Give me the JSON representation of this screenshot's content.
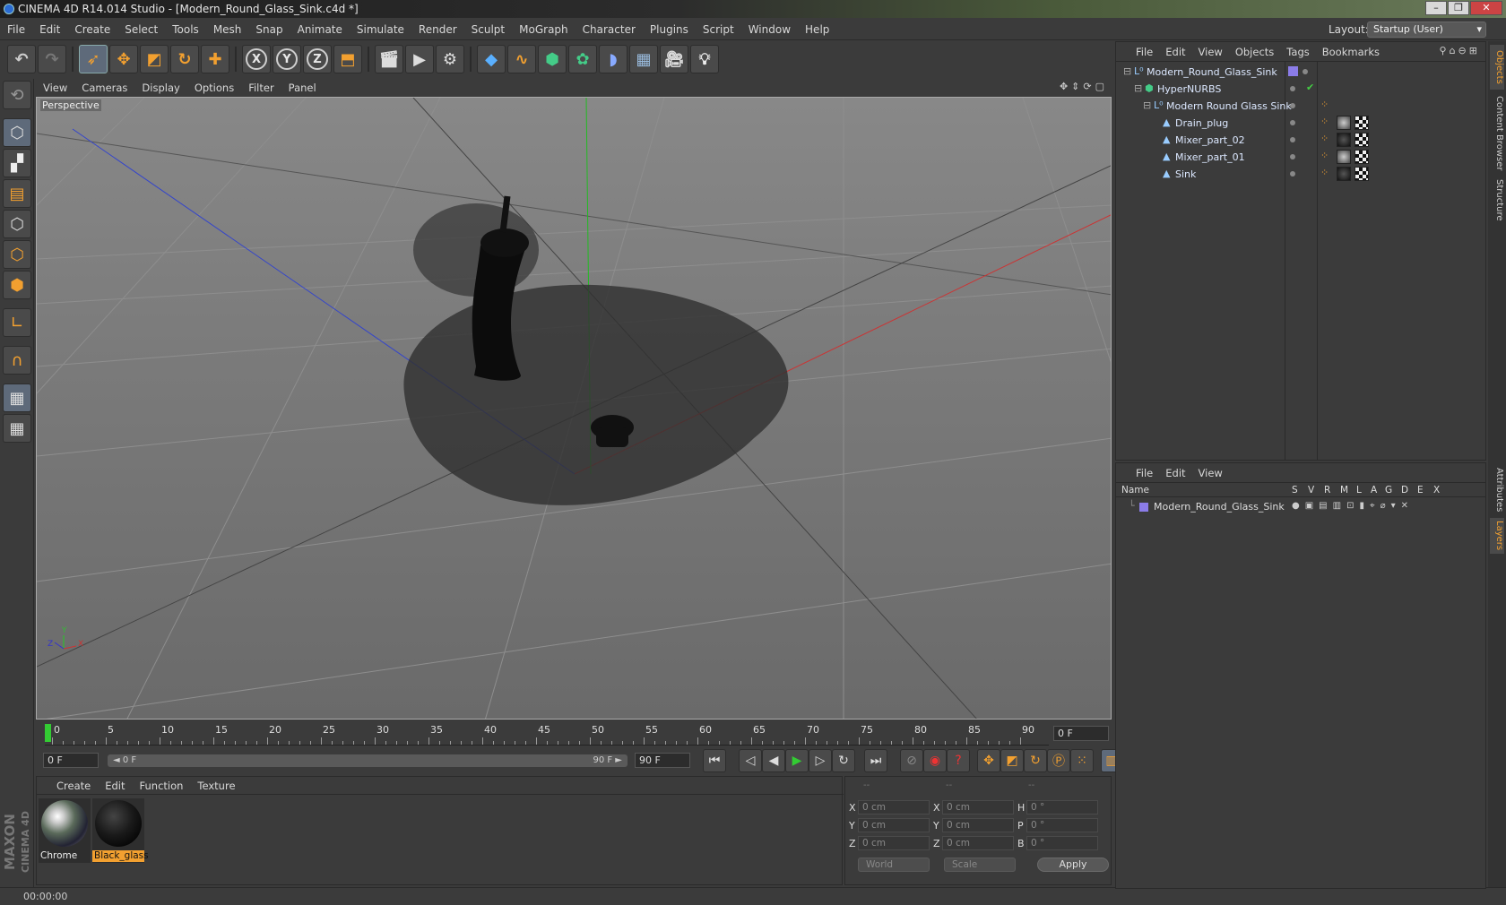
{
  "window": {
    "title": "CINEMA 4D R14.014 Studio - [Modern_Round_Glass_Sink.c4d *]",
    "buttons": [
      "–",
      "❐",
      "✕"
    ]
  },
  "menubar": {
    "items": [
      "File",
      "Edit",
      "Create",
      "Select",
      "Tools",
      "Mesh",
      "Snap",
      "Animate",
      "Simulate",
      "Render",
      "Sculpt",
      "MoGraph",
      "Character",
      "Plugins",
      "Script",
      "Window",
      "Help"
    ],
    "layout_label": "Layout:",
    "layout_value": "Startup (User)"
  },
  "toolbar": {
    "axis_x": "X",
    "axis_y": "Y",
    "axis_z": "Z"
  },
  "viewport": {
    "menu": [
      "View",
      "Cameras",
      "Display",
      "Options",
      "Filter",
      "Panel"
    ],
    "label": "Perspective",
    "axes": {
      "x": "X",
      "y": "Y",
      "z": "Z"
    }
  },
  "timeline": {
    "ticks": [
      "0",
      "5",
      "10",
      "15",
      "20",
      "25",
      "30",
      "35",
      "40",
      "45",
      "50",
      "55",
      "60",
      "65",
      "70",
      "75",
      "80",
      "85",
      "90"
    ],
    "end_frame": "0 F"
  },
  "transport": {
    "current_frame": "0 F",
    "slider_start": "◄ 0 F",
    "slider_end": "90 F ►",
    "max_frame": "90 F"
  },
  "materials": {
    "menu": [
      "Create",
      "Edit",
      "Function",
      "Texture"
    ],
    "items": [
      {
        "name": "Chrome",
        "selected": false
      },
      {
        "name": "Black_glass",
        "selected": true
      }
    ]
  },
  "coordinates": {
    "headers": [
      "--",
      "--",
      "--"
    ],
    "rows": [
      {
        "l1": "X",
        "v1": "0 cm",
        "l2": "X",
        "v2": "0 cm",
        "l3": "H",
        "v3": "0 °"
      },
      {
        "l1": "Y",
        "v1": "0 cm",
        "l2": "Y",
        "v2": "0 cm",
        "l3": "P",
        "v3": "0 °"
      },
      {
        "l1": "Z",
        "v1": "0 cm",
        "l2": "Z",
        "v2": "0 cm",
        "l3": "B",
        "v3": "0 °"
      }
    ],
    "mode_dropdown": "World",
    "type_dropdown": "Scale",
    "apply_label": "Apply"
  },
  "status": {
    "time": "00:00:00"
  },
  "objects_panel": {
    "menu": [
      "File",
      "Edit",
      "View",
      "Objects",
      "Tags",
      "Bookmarks"
    ],
    "tree": [
      {
        "name": "Modern_Round_Glass_Sink",
        "depth": 0
      },
      {
        "name": "HyperNURBS",
        "depth": 1
      },
      {
        "name": "Modern Round Glass Sink",
        "depth": 2
      },
      {
        "name": "Drain_plug",
        "depth": 3
      },
      {
        "name": "Mixer_part_02",
        "depth": 3
      },
      {
        "name": "Mixer_part_01",
        "depth": 3
      },
      {
        "name": "Sink",
        "depth": 3
      }
    ]
  },
  "layers_panel": {
    "menu": [
      "File",
      "Edit",
      "View"
    ],
    "columns": [
      "Name",
      "S",
      "V",
      "R",
      "M",
      "L",
      "A",
      "G",
      "D",
      "E",
      "X"
    ],
    "rows": [
      {
        "name": "Modern_Round_Glass_Sink"
      }
    ]
  },
  "side_tabs": [
    "Objects",
    "Content Browser",
    "Structure",
    "Attributes",
    "Layers"
  ],
  "brand": {
    "line1": "MAXON",
    "line2": "CINEMA 4D"
  },
  "colors": {
    "accent": "#f2a030",
    "selection": "#5e6a7a",
    "layer_color": "#8b7ce8"
  }
}
